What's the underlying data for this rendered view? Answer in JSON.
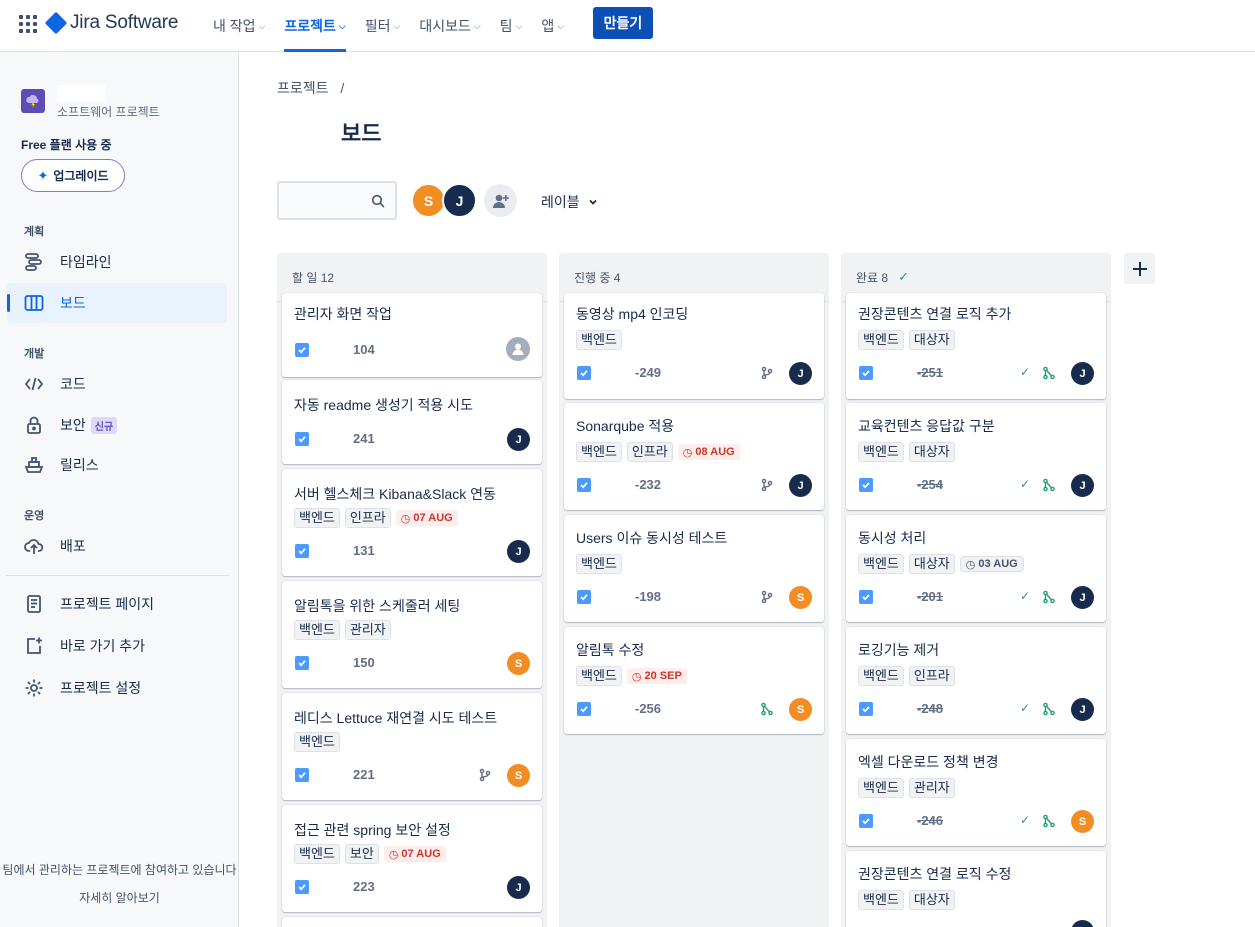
{
  "nav": {
    "logo": "Jira Software",
    "items": [
      "내 작업",
      "프로젝트",
      "필터",
      "대시보드",
      "팀",
      "앱"
    ],
    "create": "만들기"
  },
  "sidebar": {
    "project_type": "소프트웨어 프로젝트",
    "plan": "Free 플랜 사용 중",
    "upgrade": "업그레이드",
    "sections": {
      "plan": "계획",
      "dev": "개발",
      "ops": "운영"
    },
    "items": {
      "timeline": "타임라인",
      "board": "보드",
      "code": "코드",
      "security": "보안",
      "security_badge": "신규",
      "release": "릴리스",
      "deploy": "배포",
      "pages": "프로젝트 페이지",
      "shortcut": "바로 가기 추가",
      "settings": "프로젝트 설정"
    },
    "footer": "팀에서 관리하는 프로젝트에 참여하고 있습니다",
    "learn_more": "자세히 알아보기"
  },
  "header": {
    "breadcrumb": "프로젝트",
    "separator": "/",
    "title": "보드"
  },
  "filters": {
    "avatars": [
      "S",
      "J"
    ],
    "label": "레이블"
  },
  "columns": [
    {
      "title": "할 일 12",
      "cards": [
        {
          "title": "관리자 화면 작업",
          "tags": [],
          "due": "",
          "key": "104",
          "assignee": "",
          "branch": false
        },
        {
          "title": "자동 readme 생성기 적용 시도",
          "tags": [],
          "due": "",
          "key": "241",
          "assignee": "J",
          "branch": false
        },
        {
          "title": "서버 헬스체크 Kibana&Slack 연동",
          "tags": [
            "백엔드",
            "인프라"
          ],
          "due": "07 AUG",
          "key": "131",
          "assignee": "J",
          "branch": false
        },
        {
          "title": "알림톡을 위한 스케줄러 세팅",
          "tags": [
            "백엔드",
            "관리자"
          ],
          "due": "",
          "key": "150",
          "assignee": "S",
          "branch": false
        },
        {
          "title": "레디스 Lettuce 재연결 시도 테스트",
          "tags": [
            "백엔드"
          ],
          "due": "",
          "key": "221",
          "assignee": "S",
          "branch": true
        },
        {
          "title": "접근 관련 spring 보안 설정",
          "tags": [
            "백엔드",
            "보안"
          ],
          "due": "07 AUG",
          "key": "223",
          "assignee": "J",
          "branch": false
        }
      ]
    },
    {
      "title": "진행 중 4",
      "cards": [
        {
          "title": "동영상 mp4 인코딩",
          "tags": [
            "백엔드"
          ],
          "due": "",
          "key": "-249",
          "assignee": "J",
          "branch": true
        },
        {
          "title": "Sonarqube 적용",
          "tags": [
            "백엔드",
            "인프라"
          ],
          "due": "08 AUG",
          "key": "-232",
          "assignee": "J",
          "branch": true
        },
        {
          "title": "Users 이슈 동시성 테스트",
          "tags": [
            "백엔드"
          ],
          "due": "",
          "key": "-198",
          "assignee": "S",
          "branch": true
        },
        {
          "title": "알림톡 수정",
          "tags": [
            "백엔드"
          ],
          "due": "20 SEP",
          "key": "-256",
          "assignee": "S",
          "merged": true
        }
      ]
    },
    {
      "title": "완료 8",
      "cards": [
        {
          "title": "권장콘텐츠 연결 로직 추가",
          "tags": [
            "백엔드",
            "대상자"
          ],
          "due": "",
          "key": "-251",
          "assignee": "J"
        },
        {
          "title": "교육컨텐츠 응답값 구분",
          "tags": [
            "백엔드",
            "대상자"
          ],
          "due": "",
          "key": "-254",
          "assignee": "J"
        },
        {
          "title": "동시성 처리",
          "tags": [
            "백엔드",
            "대상자"
          ],
          "due": "03 AUG",
          "key": "-201",
          "assignee": "J"
        },
        {
          "title": "로깅기능 제거",
          "tags": [
            "백엔드",
            "인프라"
          ],
          "due": "",
          "key": "-248",
          "assignee": "J"
        },
        {
          "title": "엑셀 다운로드 정책 변경",
          "tags": [
            "백엔드",
            "관리자"
          ],
          "due": "",
          "key": "-246",
          "assignee": "S"
        },
        {
          "title": "권장콘텐츠 연결 로직 수정",
          "tags": [
            "백엔드",
            "대상자"
          ],
          "due": "",
          "key": "",
          "assignee": "J"
        }
      ]
    }
  ],
  "colors": {
    "accent": "#0c66e4",
    "avatar_s": "#f18d23",
    "avatar_j": "#172b4d",
    "due_red": "#c9372c",
    "done_green": "#22a06b"
  }
}
